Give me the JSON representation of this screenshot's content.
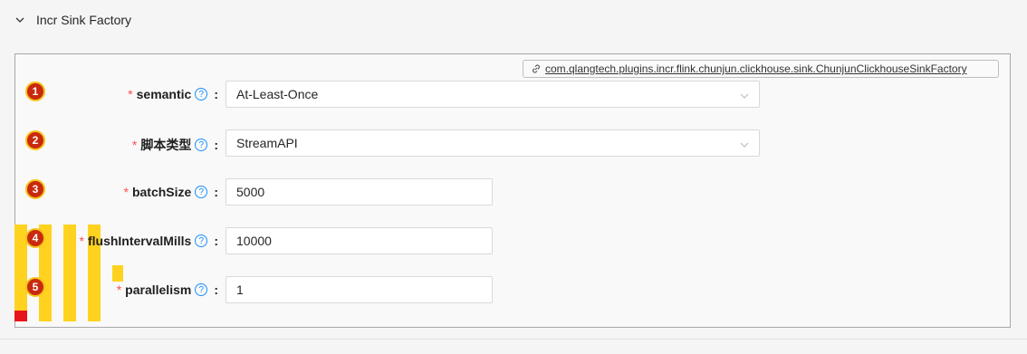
{
  "panel": {
    "title": "Incr Sink Factory"
  },
  "class_link": {
    "text": "com.qlangtech.plugins.incr.flink.chunjun.clickhouse.sink.ChunjunClickhouseSinkFactory"
  },
  "fields": [
    {
      "badge": "1",
      "required": "*",
      "label": "semantic",
      "colon": ":",
      "type": "select",
      "value": "At-Least-Once",
      "help": "?"
    },
    {
      "badge": "2",
      "required": "*",
      "label": "脚本类型",
      "colon": ":",
      "type": "select",
      "value": "StreamAPI",
      "help": "?"
    },
    {
      "badge": "3",
      "required": "*",
      "label": "batchSize",
      "colon": ":",
      "type": "input",
      "value": "5000",
      "help": "?"
    },
    {
      "badge": "4",
      "required": "*",
      "label": "flushIntervalMills",
      "colon": ":",
      "type": "input",
      "value": "10000",
      "help": "?"
    },
    {
      "badge": "5",
      "required": "*",
      "label": "parallelism",
      "colon": ":",
      "type": "input",
      "value": "1",
      "help": "?"
    }
  ],
  "icons": {
    "collapse": "chevron-down-icon",
    "link": "link-icon",
    "help": "question-circle-icon",
    "dropdown": "chevron-down-icon"
  },
  "colors": {
    "required": "#ff4d4f",
    "help": "#1890ff",
    "badge": "#c92a0c",
    "marker": "#ffd21f"
  }
}
